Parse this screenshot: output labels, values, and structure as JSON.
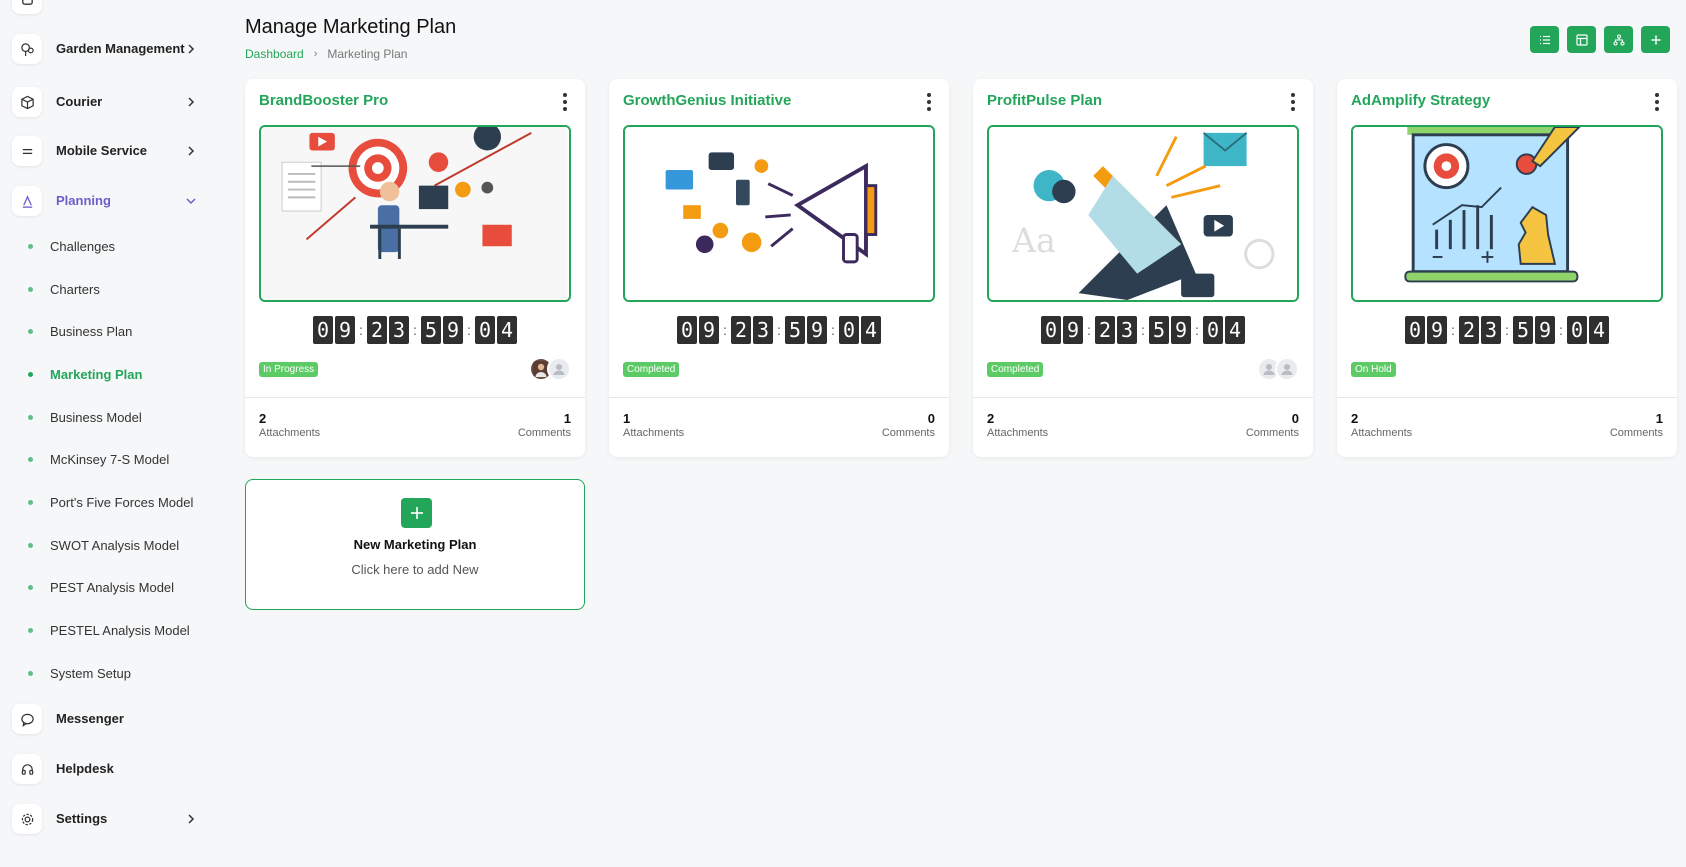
{
  "sidebar": {
    "top_items": [
      {
        "label": "Garden Management",
        "icon": "tree-icon"
      },
      {
        "label": "Courier",
        "icon": "box-icon"
      },
      {
        "label": "Mobile Service",
        "icon": "equals-icon"
      },
      {
        "label": "Planning",
        "icon": "letter-a-icon"
      }
    ],
    "sub_items": [
      {
        "label": "Challenges"
      },
      {
        "label": "Charters"
      },
      {
        "label": "Business Plan"
      },
      {
        "label": "Marketing Plan"
      },
      {
        "label": "Business Model"
      },
      {
        "label": "McKinsey 7-S Model"
      },
      {
        "label": "Port's Five Forces Model"
      },
      {
        "label": "SWOT Analysis Model"
      },
      {
        "label": "PEST Analysis Model"
      },
      {
        "label": "PESTEL Analysis Model"
      },
      {
        "label": "System Setup"
      }
    ],
    "bottom_items": [
      {
        "label": "Messenger",
        "icon": "chat-icon"
      },
      {
        "label": "Helpdesk",
        "icon": "headset-icon"
      },
      {
        "label": "Settings",
        "icon": "gear-icon"
      }
    ]
  },
  "header": {
    "title": "Manage Marketing Plan",
    "breadcrumb": {
      "home": "Dashboard",
      "current": "Marketing Plan"
    }
  },
  "toolbar": {
    "buttons": [
      "list-icon",
      "grid-icon",
      "hierarchy-icon",
      "plus-icon"
    ]
  },
  "colors": {
    "accent": "#23a55a",
    "badge": "#5ccb66",
    "active_nav": "#6a5fc9"
  },
  "cards": [
    {
      "title": "BrandBooster Pro",
      "timer": [
        "0",
        "9",
        "2",
        "3",
        "5",
        "9",
        "0",
        "4"
      ],
      "status": "In Progress",
      "attachments_count": "2",
      "attachments_label": "Attachments",
      "comments_count": "1",
      "comments_label": "Comments"
    },
    {
      "title": "GrowthGenius Initiative",
      "timer": [
        "0",
        "9",
        "2",
        "3",
        "5",
        "9",
        "0",
        "4"
      ],
      "status": "Completed",
      "attachments_count": "1",
      "attachments_label": "Attachments",
      "comments_count": "0",
      "comments_label": "Comments"
    },
    {
      "title": "ProfitPulse Plan",
      "timer": [
        "0",
        "9",
        "2",
        "3",
        "5",
        "9",
        "0",
        "4"
      ],
      "status": "Completed",
      "attachments_count": "2",
      "attachments_label": "Attachments",
      "comments_count": "0",
      "comments_label": "Comments"
    },
    {
      "title": "AdAmplify Strategy",
      "timer": [
        "0",
        "9",
        "2",
        "3",
        "5",
        "9",
        "0",
        "4"
      ],
      "status": "On Hold",
      "attachments_count": "2",
      "attachments_label": "Attachments",
      "comments_count": "1",
      "comments_label": "Comments"
    }
  ],
  "new_card": {
    "title": "New Marketing Plan",
    "subtitle": "Click here to add New"
  }
}
